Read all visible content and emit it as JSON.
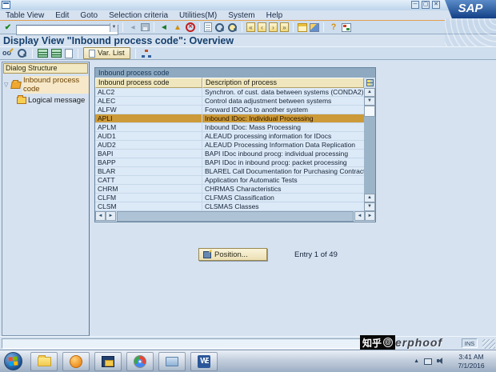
{
  "window": {
    "logo_text": "SAP",
    "menu_items": [
      "Table View",
      "Edit",
      "Goto",
      "Selection criteria",
      "Utilities(M)",
      "System",
      "Help"
    ]
  },
  "standard_toolbar": {
    "command_value": ""
  },
  "page": {
    "title": "Display View \"Inbound process code\": Overview"
  },
  "app_toolbar": {
    "var_list_label": "Var. List"
  },
  "sidebar": {
    "title": "Dialog Structure",
    "items": [
      {
        "label": "Inbound process code",
        "selected": true
      },
      {
        "label": "Logical message",
        "selected": false
      }
    ]
  },
  "table": {
    "group_title": "Inbound process code",
    "columns": [
      "Inbound process code",
      "Description of process"
    ],
    "selected_code": "APLI",
    "rows": [
      {
        "code": "ALC2",
        "desc": "Synchron. of cust. data between systems (CONDA2)"
      },
      {
        "code": "ALEC",
        "desc": "Control data adjustment between systems"
      },
      {
        "code": "ALFW",
        "desc": "Forward IDOCs to another system"
      },
      {
        "code": "APLI",
        "desc": "Inbound IDoc: Individual Processing"
      },
      {
        "code": "APLM",
        "desc": "Inbound IDoc: Mass Processing"
      },
      {
        "code": "AUD1",
        "desc": "ALEAUD  processing information for IDocs"
      },
      {
        "code": "AUD2",
        "desc": "ALEAUD Processing Information Data Replication"
      },
      {
        "code": "BAPI",
        "desc": "BAPI IDoc inbound procg: individual processing"
      },
      {
        "code": "BAPP",
        "desc": "BAPI IDoc in inbound procg: packet processing"
      },
      {
        "code": "BLAR",
        "desc": "BLAREL Call Documentation for Purchasing Contracts"
      },
      {
        "code": "CATT",
        "desc": "Application for Automatic Tests"
      },
      {
        "code": "CHRM",
        "desc": "CHRMAS Characteristics"
      },
      {
        "code": "CLFM",
        "desc": "CLFMAS  Classification"
      },
      {
        "code": "CLSM",
        "desc": "CLSMAS  Classes"
      }
    ]
  },
  "footer": {
    "position_label": "Position...",
    "entry_text": "Entry 1 of 49"
  },
  "status_bar": {
    "ins_label": "INS"
  },
  "watermark": {
    "cn": "知乎",
    "at": "@",
    "en": "erphoof"
  },
  "taskbar": {
    "time": "3:41 AM",
    "date": "7/1/2016"
  },
  "colors": {
    "selected_row": "#cd9a39",
    "table_header": "#f0e6bd",
    "accent_line": "#e0a050",
    "sap_blue": "#123f86"
  }
}
